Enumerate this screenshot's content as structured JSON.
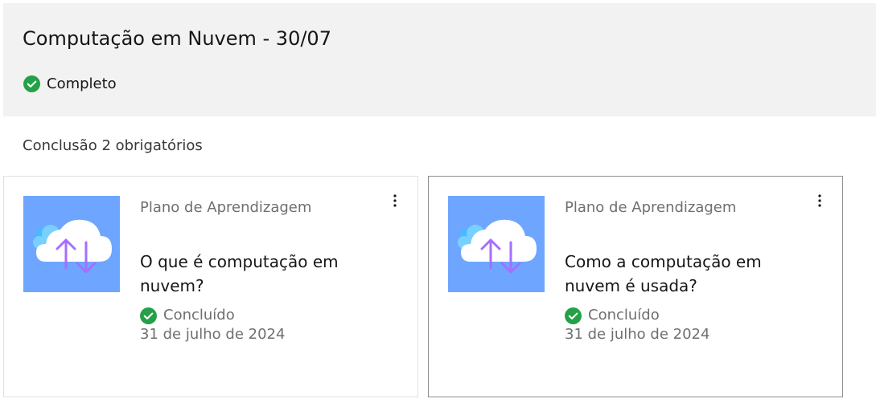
{
  "header": {
    "title": "Computação em Nuvem - 30/07",
    "status": "Completo",
    "status_icon": "checkmark-filled-icon",
    "status_color": "#24a148"
  },
  "section": {
    "label": "Conclusão 2 obrigatórios"
  },
  "cards": [
    {
      "type": "Plano de Aprendizagem",
      "title": "O que é computação em nuvem?",
      "status": "Concluído",
      "date": "31 de julho de 2024",
      "thumbnail_icon": "cloud-transfer-icon",
      "thumbnail_bg": "#6ea6ff",
      "menu_icon": "overflow-menu-vertical-icon"
    },
    {
      "type": "Plano de Aprendizagem",
      "title": "Como a computação em nuvem é usada?",
      "status": "Concluído",
      "date": "31 de julho de 2024",
      "thumbnail_icon": "cloud-transfer-icon",
      "thumbnail_bg": "#6ea6ff",
      "menu_icon": "overflow-menu-vertical-icon"
    }
  ]
}
